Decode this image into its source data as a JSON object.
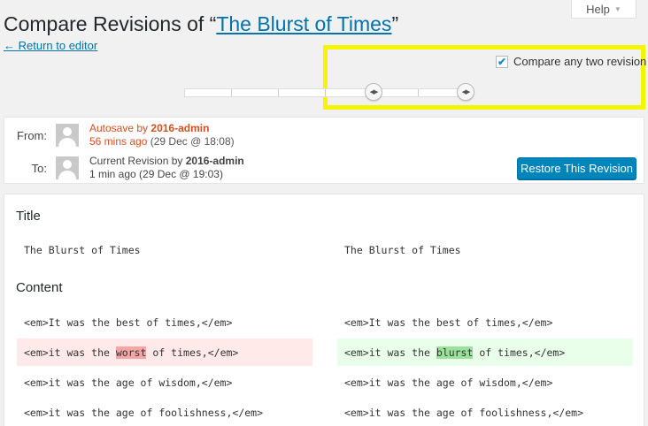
{
  "help": {
    "label": "Help"
  },
  "header": {
    "title_prefix": "Compare Revisions of “",
    "title_link": "The Blurst of Times",
    "title_suffix": "”",
    "return_link": "← Return to editor"
  },
  "controls": {
    "compare_any_label": "Compare any two revision",
    "compare_any_checked": true
  },
  "meta": {
    "from": {
      "label": "From:",
      "line1": "Autosave by",
      "author": "2016-admin",
      "line2_ago": "56 mins ago",
      "line2_date": "(29 Dec @ 18:08)"
    },
    "to": {
      "label": "To:",
      "line1": "Current Revision by",
      "author": "2016-admin",
      "line2_ago": "1 min ago",
      "line2_date": "(29 Dec @ 19:03)"
    },
    "restore_button": "Restore This Revision"
  },
  "diff": {
    "title_heading": "Title",
    "title_left": "The Blurst of Times",
    "title_right": "The Blurst of Times",
    "content_heading": "Content",
    "rows": [
      {
        "left": "<em>It was the best of times,</em>",
        "right": "<em>It was the best of times,</em>"
      },
      {
        "left_pre": "<em>it was the ",
        "left_word": "worst",
        "left_post": " of times,</em>",
        "right_pre": "<em>it was the ",
        "right_word": "blurst",
        "right_post": " of times,</em>"
      },
      {
        "left": "<em>it was the age of wisdom,</em>",
        "right": "<em>it was the age of wisdom,</em>"
      },
      {
        "left": "<em>it was the age of foolishness,</em>",
        "right": "<em>it was the age of foolishness,</em>"
      }
    ]
  },
  "colors": {
    "link": "#0073aa",
    "autosave": "#d54e21",
    "primary_button": "#0085ba",
    "highlight_box": "#f5f500",
    "deleted_bg": "#ffe9e9",
    "added_bg": "#e9ffe9"
  }
}
